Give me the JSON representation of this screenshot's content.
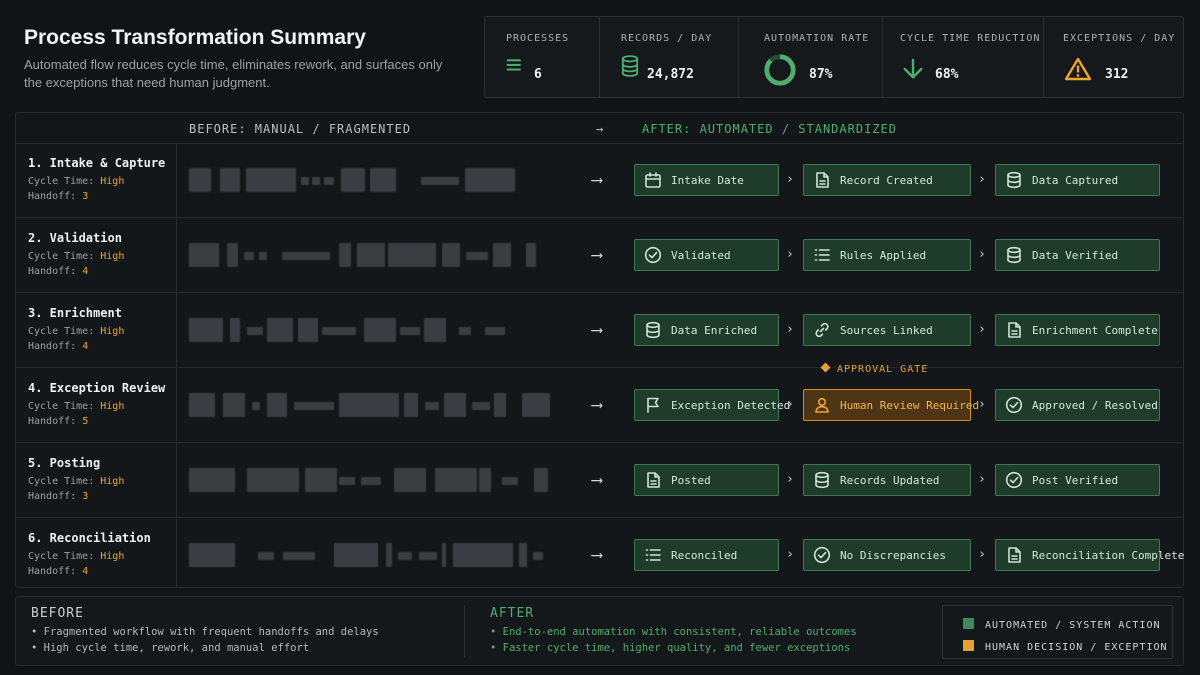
{
  "header": {
    "title": "Process Transformation Summary",
    "subtitle": "Automated flow reduces cycle time, eliminates rework, and surfaces only the exceptions that need human judgment."
  },
  "metrics": [
    {
      "label": "PROCESSES",
      "value": "6",
      "icon": "list-icon"
    },
    {
      "label": "RECORDS / DAY",
      "value": "24,872",
      "icon": "database-icon"
    },
    {
      "label": "AUTOMATION RATE",
      "value": "87%",
      "icon": "progress-ring-icon",
      "progress": 0.87
    },
    {
      "label": "CYCLE TIME REDUCTION",
      "value": "68%",
      "icon": "arrow-down-icon"
    },
    {
      "label": "EXCEPTIONS / DAY",
      "value": "312",
      "icon": "warning-icon"
    }
  ],
  "table": {
    "before_header": "BEFORE: MANUAL / FRAGMENTED",
    "arrow": "→",
    "after_header": "AFTER: AUTOMATED / STANDARDIZED",
    "cycle_label": "Cycle Time:",
    "handoff_label": "Handoff:",
    "approval_gate": "APPROVAL GATE",
    "rows": [
      {
        "name": "1. Intake & Capture",
        "cycle": "High",
        "handoff": "3",
        "steps": [
          {
            "label": "Intake Date",
            "icon": "calendar-icon"
          },
          {
            "label": "Record Created",
            "icon": "document-icon"
          },
          {
            "label": "Data Captured",
            "icon": "database-icon"
          }
        ]
      },
      {
        "name": "2. Validation",
        "cycle": "High",
        "handoff": "4",
        "steps": [
          {
            "label": "Validated",
            "icon": "check-circle-icon"
          },
          {
            "label": "Rules Applied",
            "icon": "list-icon"
          },
          {
            "label": "Data Verified",
            "icon": "database-icon"
          }
        ]
      },
      {
        "name": "3. Enrichment",
        "cycle": "High",
        "handoff": "4",
        "steps": [
          {
            "label": "Data Enriched",
            "icon": "database-icon"
          },
          {
            "label": "Sources Linked",
            "icon": "link-icon"
          },
          {
            "label": "Enrichment Complete",
            "icon": "document-icon"
          }
        ]
      },
      {
        "name": "4. Exception Review",
        "cycle": "High",
        "handoff": "5",
        "steps": [
          {
            "label": "Exception Detected",
            "icon": "flag-icon"
          },
          {
            "label": "Human Review Required",
            "icon": "user-icon"
          },
          {
            "label": "Approved / Resolved",
            "icon": "check-circle-icon"
          }
        ]
      },
      {
        "name": "5. Posting",
        "cycle": "High",
        "handoff": "3",
        "steps": [
          {
            "label": "Posted",
            "icon": "document-icon"
          },
          {
            "label": "Records Updated",
            "icon": "database-icon"
          },
          {
            "label": "Post Verified",
            "icon": "check-circle-icon"
          }
        ]
      },
      {
        "name": "6. Reconciliation",
        "cycle": "High",
        "handoff": "4",
        "steps": [
          {
            "label": "Reconciled",
            "icon": "list-icon"
          },
          {
            "label": "No Discrepancies",
            "icon": "check-circle-icon"
          },
          {
            "label": "Reconciliation Complete",
            "icon": "document-icon"
          }
        ]
      }
    ]
  },
  "footer": {
    "before_title": "BEFORE",
    "before_points": [
      "• Fragmented workflow with frequent handoffs and delays",
      "• High cycle time, rework, and manual effort"
    ],
    "after_title": "AFTER",
    "after_points": [
      "• End-to-end automation with consistent, reliable outcomes",
      "• Faster cycle time, higher quality, and fewer exceptions"
    ],
    "legend": [
      {
        "label": "AUTOMATED / SYSTEM ACTION",
        "color": "#3f8a5a"
      },
      {
        "label": "HUMAN DECISION / EXCEPTION",
        "color": "#e6a03a"
      }
    ]
  },
  "colors": {
    "accent_green": "#4fae6d",
    "accent_amber": "#f0a531",
    "background": "#111417"
  }
}
